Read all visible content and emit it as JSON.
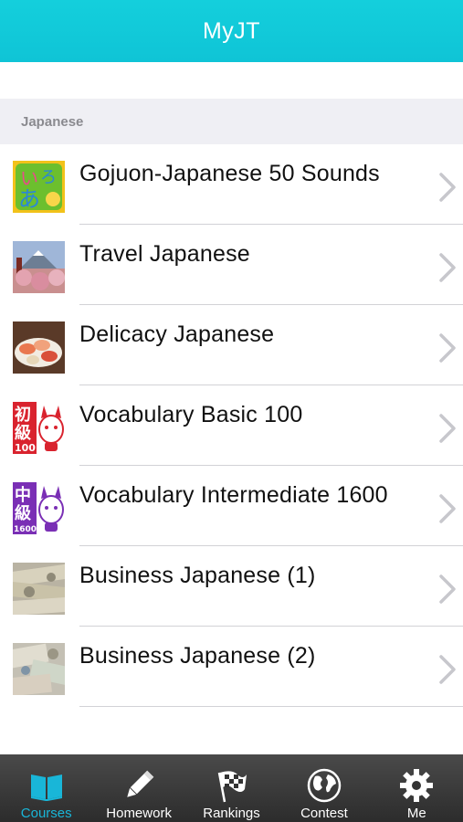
{
  "header": {
    "title": "MyJT"
  },
  "section": {
    "title": "Japanese"
  },
  "courses": [
    {
      "label": "Gojuon-Japanese 50 Sounds",
      "thumb": "gojuon-icon"
    },
    {
      "label": "Travel Japanese",
      "thumb": "travel-photo"
    },
    {
      "label": "Delicacy Japanese",
      "thumb": "sushi-photo"
    },
    {
      "label": "Vocabulary Basic 100",
      "thumb": "vocab-basic-icon"
    },
    {
      "label": "Vocabulary Intermediate 1600",
      "thumb": "vocab-intermediate-icon"
    },
    {
      "label": "Business Japanese (1)",
      "thumb": "banknotes-photo"
    },
    {
      "label": "Business Japanese (2)",
      "thumb": "banknotes-photo"
    }
  ],
  "thumb_text": {
    "gojuon": [
      "い",
      "ろ",
      "あ"
    ],
    "vocab_basic": [
      "初",
      "級",
      "100"
    ],
    "vocab_intermediate": [
      "中",
      "級",
      "1600"
    ]
  },
  "tabs": [
    {
      "label": "Courses",
      "icon": "book-icon",
      "active": true
    },
    {
      "label": "Homework",
      "icon": "pencil-icon",
      "active": false
    },
    {
      "label": "Rankings",
      "icon": "checkered-flag-icon",
      "active": false
    },
    {
      "label": "Contest",
      "icon": "globe-icon",
      "active": false
    },
    {
      "label": "Me",
      "icon": "gear-icon",
      "active": false
    }
  ],
  "colors": {
    "header": "#0fc4d6",
    "section_bg": "#efeff4",
    "tabbar": "#333333",
    "tab_active": "#19b6d8"
  }
}
